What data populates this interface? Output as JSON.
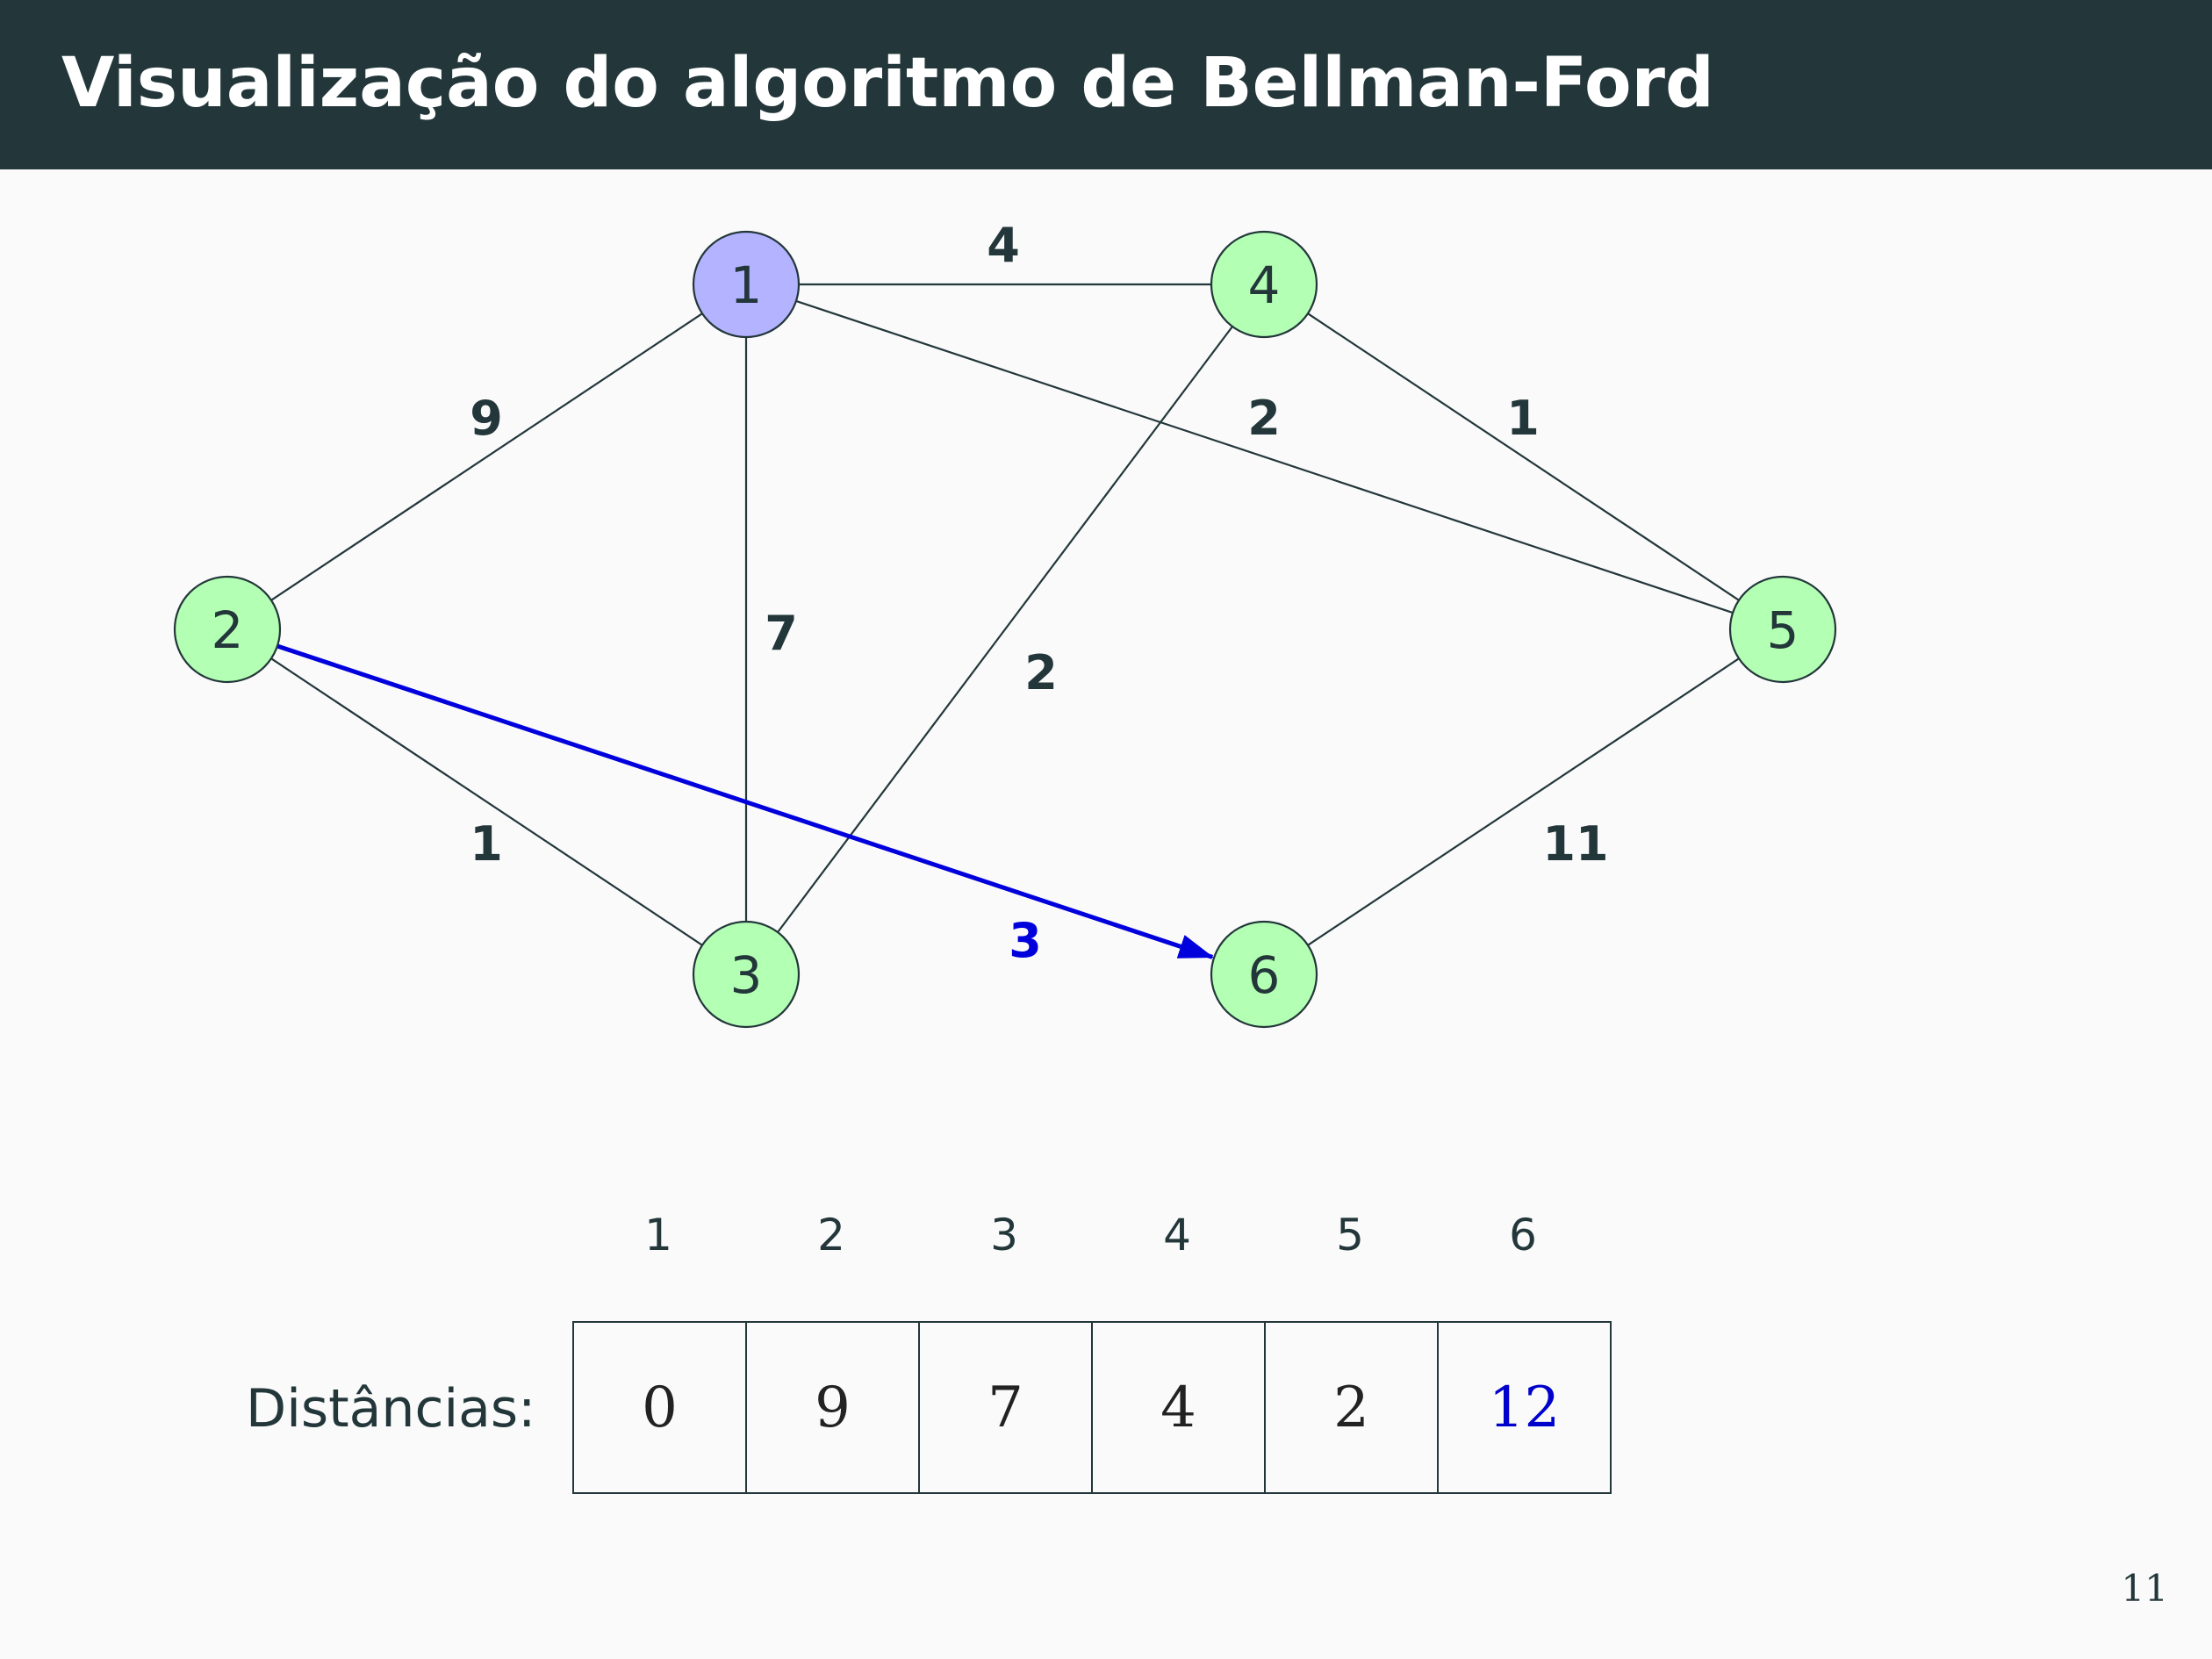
{
  "slide": {
    "title": "Visualização do algoritmo de Bellman-Ford",
    "page_number": "11"
  },
  "colors": {
    "header_bg": "#23373b",
    "source_node": "#b3b3ff",
    "node": "#b3ffb3",
    "highlight": "#0000dd"
  },
  "graph": {
    "nodes": [
      {
        "id": "1",
        "label": "1",
        "source": true
      },
      {
        "id": "2",
        "label": "2"
      },
      {
        "id": "3",
        "label": "3"
      },
      {
        "id": "4",
        "label": "4"
      },
      {
        "id": "5",
        "label": "5"
      },
      {
        "id": "6",
        "label": "6"
      }
    ],
    "edges": [
      {
        "from": "1",
        "to": "4",
        "weight": "4"
      },
      {
        "from": "1",
        "to": "2",
        "weight": "9"
      },
      {
        "from": "1",
        "to": "3",
        "weight": "7"
      },
      {
        "from": "1",
        "to": "5",
        "weight": "2"
      },
      {
        "from": "4",
        "to": "5",
        "weight": "1"
      },
      {
        "from": "4",
        "to": "3",
        "weight": "2"
      },
      {
        "from": "2",
        "to": "3",
        "weight": "1"
      },
      {
        "from": "5",
        "to": "6",
        "weight": "11"
      },
      {
        "from": "2",
        "to": "6",
        "weight": "3",
        "highlighted": true,
        "directed": true
      }
    ]
  },
  "distances": {
    "label": "Distâncias:",
    "headers": [
      "1",
      "2",
      "3",
      "4",
      "5",
      "6"
    ],
    "values": [
      "0",
      "9",
      "7",
      "4",
      "2",
      "12"
    ],
    "highlighted_index": 5
  }
}
